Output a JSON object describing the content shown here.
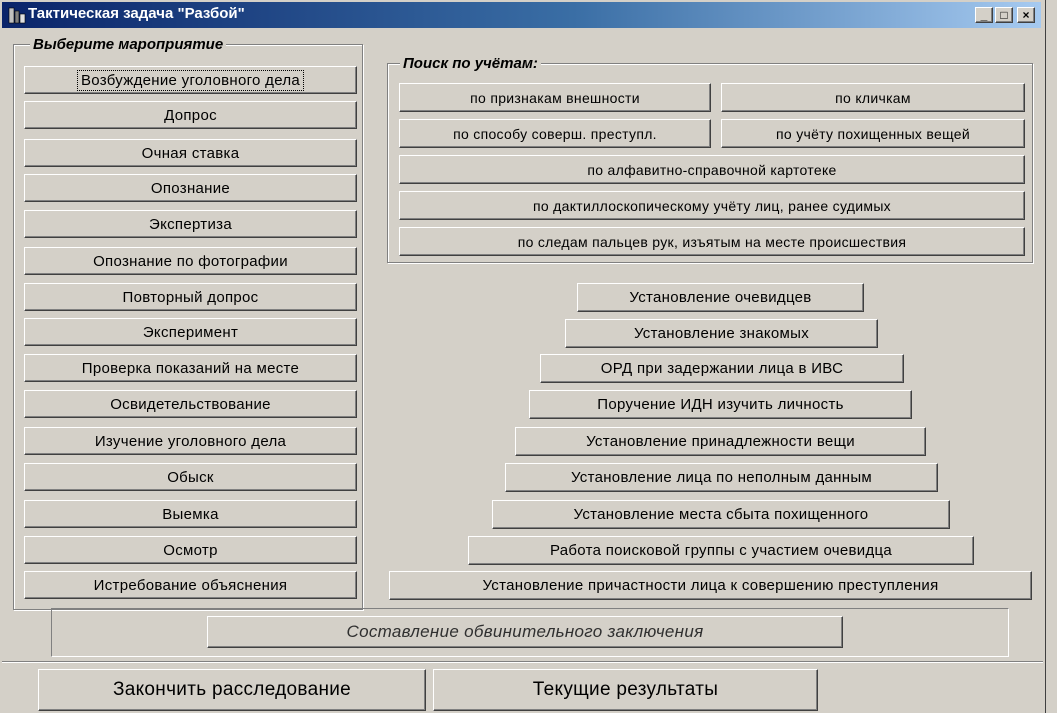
{
  "window": {
    "title": "Тактическая задача \"Разбой\"",
    "caption_buttons": {
      "minimize": "_",
      "maximize": "□",
      "close": "×"
    }
  },
  "events_group": {
    "label": "Выберите мароприятие",
    "buttons": [
      "Возбуждение уголовного дела",
      "Допрос",
      "Очная ставка",
      "Опознание",
      "Экспертиза",
      "Опознание по фотографии",
      "Повторный допрос",
      "Эксперимент",
      "Проверка показаний на месте",
      "Освидетельствование",
      "Изучение уголовного дела",
      "Обыск",
      "Выемка",
      "Осмотр",
      "Истребование объяснения"
    ]
  },
  "search_group": {
    "label": "Поиск по учётам:",
    "buttons": [
      "по признакам внешности",
      "по кличкам",
      "по способу соверш. преступл.",
      "по учёту похищенных вещей",
      "по алфавитно-справочной картотеке",
      "по дактиллоскопическому учёту лиц, ранее судимых",
      "по следам пальцев рук, изъятым на месте происшествия"
    ]
  },
  "operations": {
    "buttons": [
      "Установление очевидцев",
      "Установление знакомых",
      "ОРД при задержании лица в ИВС",
      "Поручение ИДН изучить личность",
      "Установление принадлежности вещи",
      "Установление лица по неполным данным",
      "Установление места сбыта похищенного",
      "Работа поисковой группы с участием очевидца",
      "Установление причастности лица к совершению преступления"
    ]
  },
  "conclusion": {
    "button": "Составление обвинительного заключения"
  },
  "footer": {
    "finish": "Закончить расследование",
    "results": "Текущие результаты"
  }
}
